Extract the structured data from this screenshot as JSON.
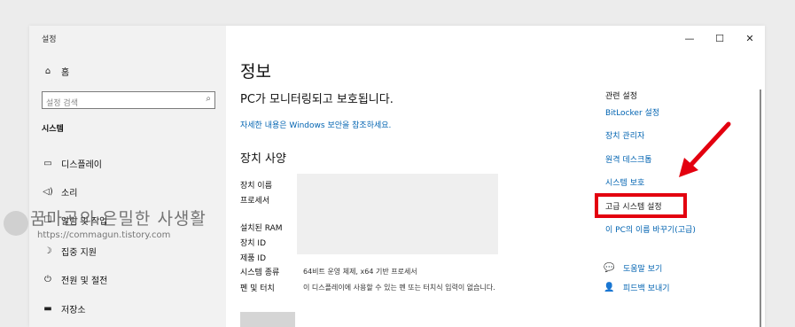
{
  "window": {
    "title": "설정",
    "minimize": "—",
    "maximize": "☐",
    "close": "✕"
  },
  "sidebar": {
    "home": "홈",
    "search_placeholder": "설정 검색",
    "section": "시스템",
    "items": [
      {
        "label": "디스플레이",
        "icon": "monitor-icon"
      },
      {
        "label": "소리",
        "icon": "speaker-icon"
      },
      {
        "label": "알림 및 작업",
        "icon": "notification-icon"
      },
      {
        "label": "집중 지원",
        "icon": "moon-icon"
      },
      {
        "label": "전원 및 절전",
        "icon": "power-icon"
      },
      {
        "label": "저장소",
        "icon": "storage-icon"
      }
    ]
  },
  "watermark": {
    "title": "꿈마곤의 은밀한 사생활",
    "url": "https://commagun.tistory.com"
  },
  "main": {
    "title": "정보",
    "protect": "PC가 모니터링되고 보호됩니다.",
    "details_link": "자세한 내용은 Windows 보안을 참조하세요.",
    "spec_heading": "장치 사양",
    "specs": [
      {
        "label": "장치 이름",
        "value": ""
      },
      {
        "label": "프로세서",
        "value": ""
      },
      {
        "label": "설치된 RAM",
        "value": ""
      },
      {
        "label": "장치 ID",
        "value": ""
      },
      {
        "label": "제품 ID",
        "value": ""
      },
      {
        "label": "시스템 종류",
        "value": "64비트 운영 체제, x64 기반 프로세서"
      },
      {
        "label": "펜 및 터치",
        "value": "이 디스플레이에 사용할 수 있는 펜 또는 터치식 입력이 없습니다."
      }
    ]
  },
  "related": {
    "title": "관련 설정",
    "links": [
      "BitLocker 설정",
      "장치 관리자",
      "원격 데스크톱",
      "시스템 보호",
      "고급 시스템 설정",
      "이 PC의 이름 바꾸기(고급)"
    ],
    "help": "도움말 보기",
    "feedback": "피드백 보내기"
  },
  "annotation_color": "#e3000f",
  "link_color": "#0063b1"
}
